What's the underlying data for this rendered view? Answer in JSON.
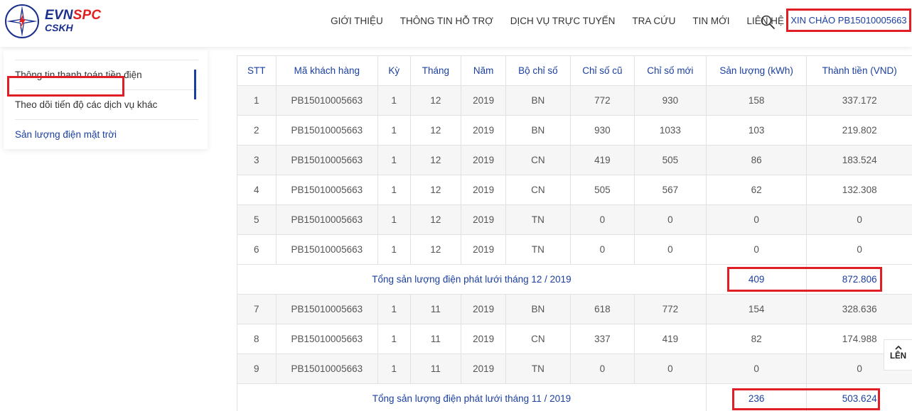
{
  "brand": {
    "evn": "EVN",
    "spc": "SPC",
    "sub": "CSKH"
  },
  "nav": [
    "GIỚI THIỆU",
    "THÔNG TIN HỖ TRỢ",
    "DỊCH VỤ TRỰC TUYẾN",
    "TRA CỨU",
    "TIN MỚI",
    "LIÊN HỆ"
  ],
  "greeting": "XIN CHÀO PB15010005663",
  "sidebar": {
    "items": [
      "Thông tin thanh toán tiền điện",
      "Theo dõi tiến độ các dịch vụ khác",
      "Sản lượng điện mặt trời"
    ],
    "active_index": 2
  },
  "table": {
    "headers": [
      "STT",
      "Mã khách hàng",
      "Kỳ",
      "Tháng",
      "Năm",
      "Bộ chỉ số",
      "Chỉ số cũ",
      "Chỉ số mới",
      "Sản lượng (kWh)",
      "Thành tiền (VND)"
    ],
    "rows": [
      [
        "1",
        "PB15010005663",
        "1",
        "12",
        "2019",
        "BN",
        "772",
        "930",
        "158",
        "337.172"
      ],
      [
        "2",
        "PB15010005663",
        "1",
        "12",
        "2019",
        "BN",
        "930",
        "1033",
        "103",
        "219.802"
      ],
      [
        "3",
        "PB15010005663",
        "1",
        "12",
        "2019",
        "CN",
        "419",
        "505",
        "86",
        "183.524"
      ],
      [
        "4",
        "PB15010005663",
        "1",
        "12",
        "2019",
        "CN",
        "505",
        "567",
        "62",
        "132.308"
      ],
      [
        "5",
        "PB15010005663",
        "1",
        "12",
        "2019",
        "TN",
        "0",
        "0",
        "0",
        "0"
      ],
      [
        "6",
        "PB15010005663",
        "1",
        "12",
        "2019",
        "TN",
        "0",
        "0",
        "0",
        "0"
      ],
      [
        "7",
        "PB15010005663",
        "1",
        "11",
        "2019",
        "BN",
        "618",
        "772",
        "154",
        "328.636"
      ],
      [
        "8",
        "PB15010005663",
        "1",
        "11",
        "2019",
        "CN",
        "337",
        "419",
        "82",
        "174.988"
      ],
      [
        "9",
        "PB15010005663",
        "1",
        "11",
        "2019",
        "TN",
        "0",
        "0",
        "0",
        "0"
      ]
    ],
    "totals": [
      {
        "label": "Tổng sản lượng điện phát lưới tháng 12 / 2019",
        "kwh": "409",
        "amount": "872.806"
      },
      {
        "label": "Tổng sản lượng điện phát lưới tháng 11 / 2019",
        "kwh": "236",
        "amount": "503.624"
      }
    ]
  },
  "up_button": {
    "label": "LÊN"
  },
  "colors": {
    "accent": "#1b3fa0",
    "highlight": "#e01e26",
    "brand_red": "#e02020"
  }
}
